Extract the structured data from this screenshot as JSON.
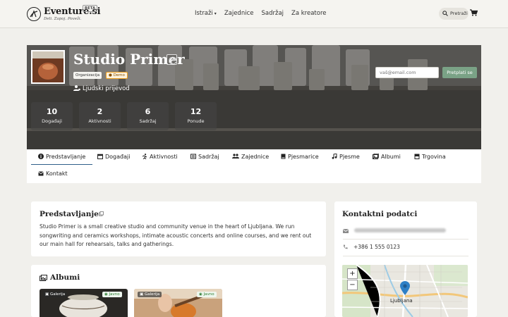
{
  "header": {
    "brand": "Eventure.si",
    "beta": "BETA",
    "tagline": "Deli. Zapoj. Poveži.",
    "nav": [
      "Istraži",
      "Zajednice",
      "Sadržaj",
      "Za kreatore"
    ],
    "search_label": "Pretraži",
    "icons": {
      "menu_caret": "chevron-down-icon",
      "search": "search-icon",
      "cart": "cart-icon"
    }
  },
  "hero": {
    "title": "Studio Primer",
    "badge_type": "Organizacija",
    "badge_demo": "Demo",
    "category": "Ljudski prijevod",
    "email_placeholder": "vaš@email.com",
    "subscribe_label": "Pretplati se",
    "stats": [
      {
        "value": "10",
        "label": "Događaji"
      },
      {
        "value": "2",
        "label": "Aktivnosti"
      },
      {
        "value": "6",
        "label": "Sadržaj"
      },
      {
        "value": "12",
        "label": "Ponude"
      }
    ]
  },
  "tabs": [
    {
      "label": "Predstavljanje",
      "icon": "info-icon",
      "active": true
    },
    {
      "label": "Događaji",
      "icon": "calendar-icon"
    },
    {
      "label": "Aktivnosti",
      "icon": "running-icon"
    },
    {
      "label": "Sadržaj",
      "icon": "content-icon"
    },
    {
      "label": "Zajednice",
      "icon": "users-icon"
    },
    {
      "label": "Pjesmarice",
      "icon": "book-icon"
    },
    {
      "label": "Pjesme",
      "icon": "music-icon"
    },
    {
      "label": "Albumi",
      "icon": "images-icon"
    },
    {
      "label": "Trgovina",
      "icon": "store-icon"
    },
    {
      "label": "Kontakt",
      "icon": "envelope-icon"
    }
  ],
  "about": {
    "title": "Predstavljanje",
    "text": "Studio Primer is a small creative studio and community venue in the heart of Ljubljana. We run songwriting and ceramics workshops, intimate acoustic concerts and online courses, and we rent out our main hall for rehearsals, talks and gatherings."
  },
  "contact": {
    "title": "Kontaktni podatci",
    "phone": "+386 1 555 0123",
    "map_city": "Ljubljana",
    "zoom_in": "+",
    "zoom_out": "−"
  },
  "albums": {
    "title": "Albumi",
    "items": [
      {
        "type": "Galerija",
        "visibility": "Javno"
      },
      {
        "type": "Galerija",
        "visibility": "Javno"
      }
    ]
  },
  "colors": {
    "accent": "#2f5f8a",
    "subscribe": "#7aa286",
    "demo": "#f0a020",
    "public": "#2e7d32"
  }
}
